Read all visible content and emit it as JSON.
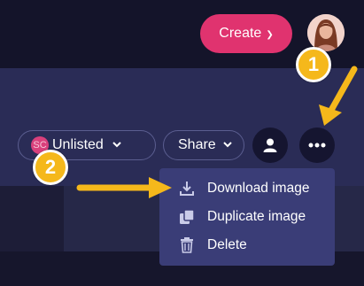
{
  "header": {
    "create_label": "Create",
    "avatar": "avatar"
  },
  "toolbar": {
    "visibility_badge": "SC",
    "visibility_label": "Unlisted",
    "share_label": "Share"
  },
  "menu": {
    "items": [
      {
        "label": "Download image",
        "icon": "download-icon"
      },
      {
        "label": "Duplicate image",
        "icon": "duplicate-icon"
      },
      {
        "label": "Delete",
        "icon": "trash-icon"
      }
    ]
  },
  "annotations": {
    "step1": "1",
    "step2": "2"
  },
  "colors": {
    "accent": "#e0336f",
    "badge": "#f5b81b",
    "arrow": "#f5b81b"
  }
}
